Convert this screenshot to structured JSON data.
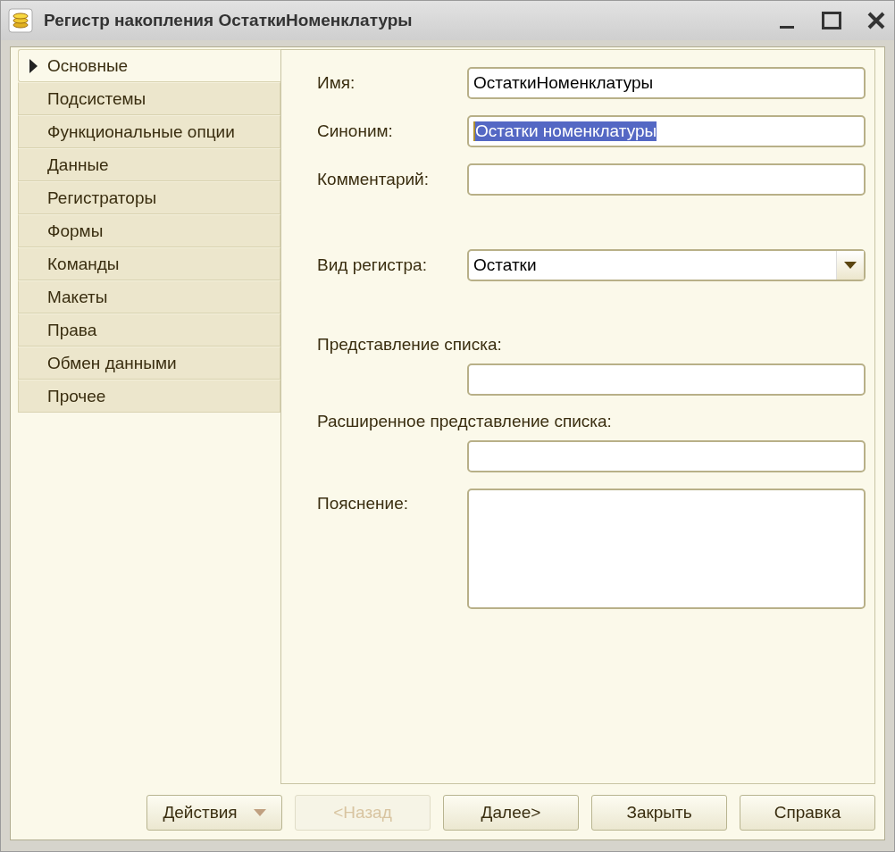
{
  "window": {
    "title": "Регистр накопления ОстаткиНоменклатуры"
  },
  "sidebar": {
    "items": [
      {
        "label": "Основные",
        "selected": true
      },
      {
        "label": "Подсистемы",
        "selected": false
      },
      {
        "label": "Функциональные опции",
        "selected": false
      },
      {
        "label": "Данные",
        "selected": false
      },
      {
        "label": "Регистраторы",
        "selected": false
      },
      {
        "label": "Формы",
        "selected": false
      },
      {
        "label": "Команды",
        "selected": false
      },
      {
        "label": "Макеты",
        "selected": false
      },
      {
        "label": "Права",
        "selected": false
      },
      {
        "label": "Обмен данными",
        "selected": false
      },
      {
        "label": "Прочее",
        "selected": false
      }
    ]
  },
  "field_groups": [
    [
      {
        "kind": "inline",
        "label": "Имя:",
        "value": "ОстаткиНоменклатуры"
      },
      {
        "kind": "inline",
        "label": "Синоним:",
        "value": "Остатки номенклатуры",
        "text_selected": true
      },
      {
        "kind": "inline",
        "label": "Комментарий:"
      }
    ],
    [
      {
        "kind": "select",
        "label": "Вид регистра:",
        "value": "Остатки"
      }
    ],
    [
      {
        "kind": "stacked",
        "label": "Представление списка:"
      },
      {
        "kind": "stacked",
        "label": "Расширенное представление списка:"
      },
      {
        "kind": "memo",
        "label": "Пояснение:"
      }
    ]
  ],
  "buttons": [
    {
      "label": "Действия",
      "kind": "menu",
      "disabled": false
    },
    {
      "label": "<Назад",
      "kind": "plain",
      "disabled": true
    },
    {
      "label": "Далее>",
      "kind": "plain",
      "disabled": false
    },
    {
      "label": "Закрыть",
      "kind": "plain",
      "disabled": false
    },
    {
      "label": "Справка",
      "kind": "plain",
      "disabled": false
    }
  ]
}
